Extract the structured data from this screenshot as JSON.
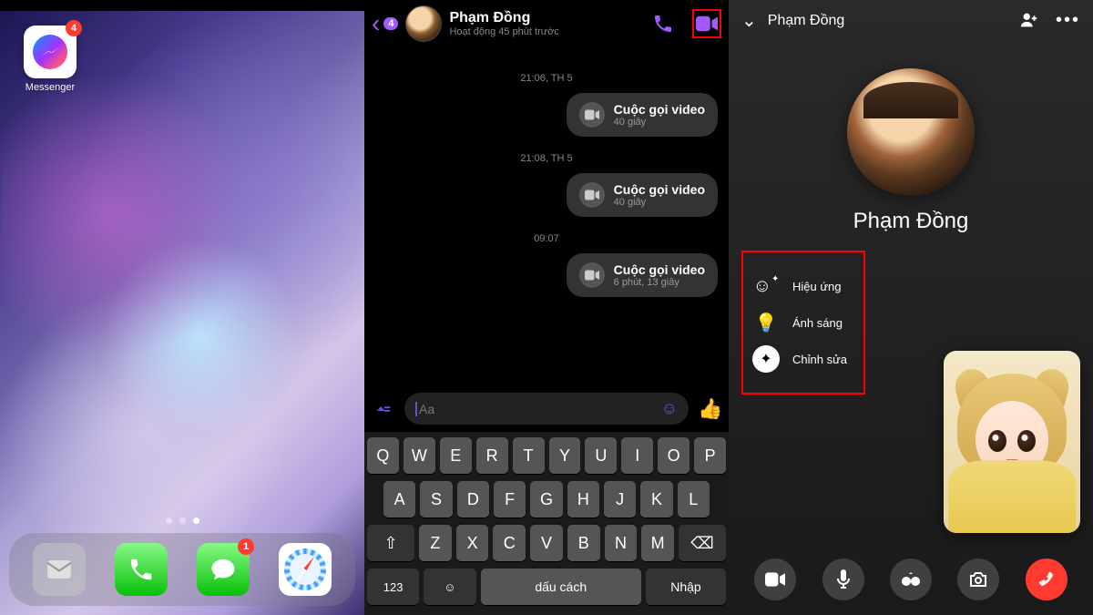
{
  "panel1": {
    "messenger": {
      "label": "Messenger",
      "badge": "4"
    },
    "dock_badges": {
      "messages": "1"
    }
  },
  "panel2": {
    "back_badge": "4",
    "contact_name": "Phạm Đồng",
    "activity_status": "Hoạt động 45 phút trước",
    "timestamps": [
      "21:06, TH 5",
      "21:08, TH 5",
      "09:07"
    ],
    "call_entries": [
      {
        "title": "Cuộc gọi video",
        "sub": "40 giây"
      },
      {
        "title": "Cuộc gọi video",
        "sub": "40 giây"
      },
      {
        "title": "Cuộc gọi video",
        "sub": "6 phút, 13 giây"
      }
    ],
    "input_placeholder": "Aa",
    "keyboard": {
      "row1": [
        "Q",
        "W",
        "E",
        "R",
        "T",
        "Y",
        "U",
        "I",
        "O",
        "P"
      ],
      "row2": [
        "A",
        "S",
        "D",
        "F",
        "G",
        "H",
        "J",
        "K",
        "L"
      ],
      "row3_mid": [
        "Z",
        "X",
        "C",
        "V",
        "B",
        "N",
        "M"
      ],
      "numbers_key": "123",
      "space_key": "dấu cách",
      "return_key": "Nhập"
    }
  },
  "panel3": {
    "contact_name": "Phạm Đồng",
    "big_name": "Phạm Đồng",
    "effects_menu": [
      {
        "label": "Hiệu ứng"
      },
      {
        "label": "Ánh sáng"
      },
      {
        "label": "Chỉnh sửa"
      }
    ]
  }
}
